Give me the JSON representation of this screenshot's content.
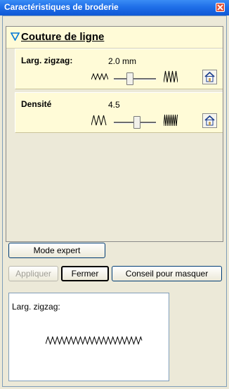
{
  "window": {
    "title": "Caractéristiques de broderie"
  },
  "section": {
    "title": "Couture de ligne"
  },
  "settings": [
    {
      "label": "Larg. zigzag:",
      "value": "2.0 mm",
      "slider_fraction": 0.35
    },
    {
      "label": "Densité",
      "value": "4.5",
      "slider_fraction": 0.55
    }
  ],
  "buttons": {
    "mode_expert": "Mode expert",
    "appliquer": "Appliquer",
    "fermer": "Fermer",
    "conseil": "Conseil pour masquer"
  },
  "preview": {
    "label": "Larg. zigzag:"
  },
  "colors": {
    "title_bar": "#1f6fe8",
    "panel_bg": "#fffbd7",
    "accent_triangle": "#0078d7",
    "stitch": "#000000"
  }
}
